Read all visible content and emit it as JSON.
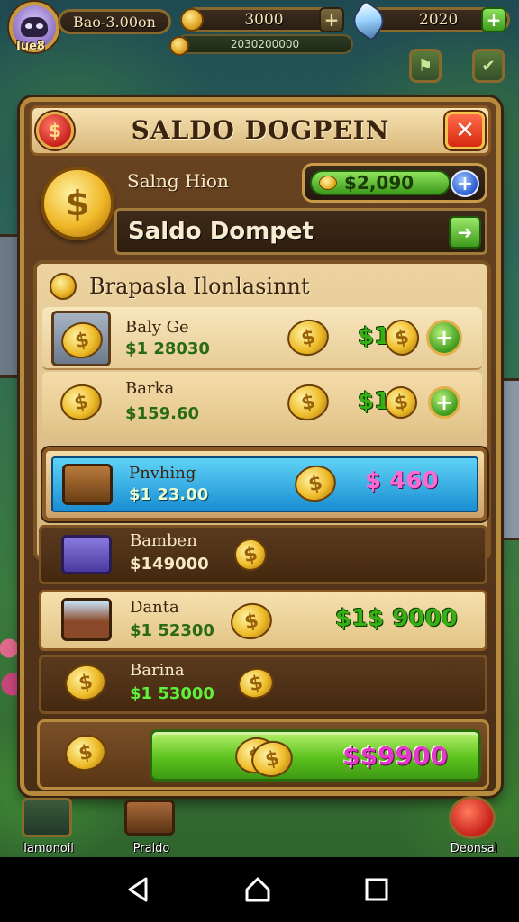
{
  "hud": {
    "player_name": "Iue8",
    "bar1": "Bao-3.00on",
    "bar2": "3000",
    "bar3": "2020",
    "sub_bar": "2030200000",
    "plus1": "+",
    "plus2": "+"
  },
  "panel": {
    "title": "SALDO DOGPEIN",
    "left_btn": "$",
    "close_btn": "✕",
    "balance_label": "Salng Hion",
    "balance_value": "$2,090",
    "balance_plus": "+",
    "wallet_label": "Saldo Dompet",
    "wallet_go": "➜"
  },
  "section": {
    "heading": "Brapasla Ilonlasinnt",
    "rows": [
      {
        "name": "Baly Ge",
        "price": "$1 28030",
        "cost": "$1"
      },
      {
        "name": "Barka",
        "price": "$159.60",
        "cost": "$1"
      },
      {
        "name": "Pnvhing",
        "price": "$1 23.00",
        "cost": "$ 460"
      },
      {
        "name": "Bamben",
        "price": "$149000"
      },
      {
        "name": "Danta",
        "price": "$1 52300",
        "cost": "$1$ 9000"
      },
      {
        "name": "Barina",
        "price": "$1 53000"
      }
    ]
  },
  "bottom": {
    "button_value": "$$9900"
  },
  "game_nav": [
    {
      "label": "Iamonoil"
    },
    {
      "label": "Praldo"
    },
    {
      "label": "Deonsal"
    }
  ],
  "colors": {
    "panel_border": "#b88a3c",
    "title_bg": "#e6c892",
    "accent_green": "#5cc21e",
    "highlight_blue": "#1a8ed2",
    "price_green": "#2a6a12",
    "bottom_text": "#e23ac8"
  },
  "icons": {
    "avatar": "alien-avatar-icon",
    "coin": "gold-coin-icon",
    "crystal": "crystal-icon",
    "chest": "treasure-chest-icon",
    "close": "close-icon",
    "plus": "plus-icon"
  }
}
